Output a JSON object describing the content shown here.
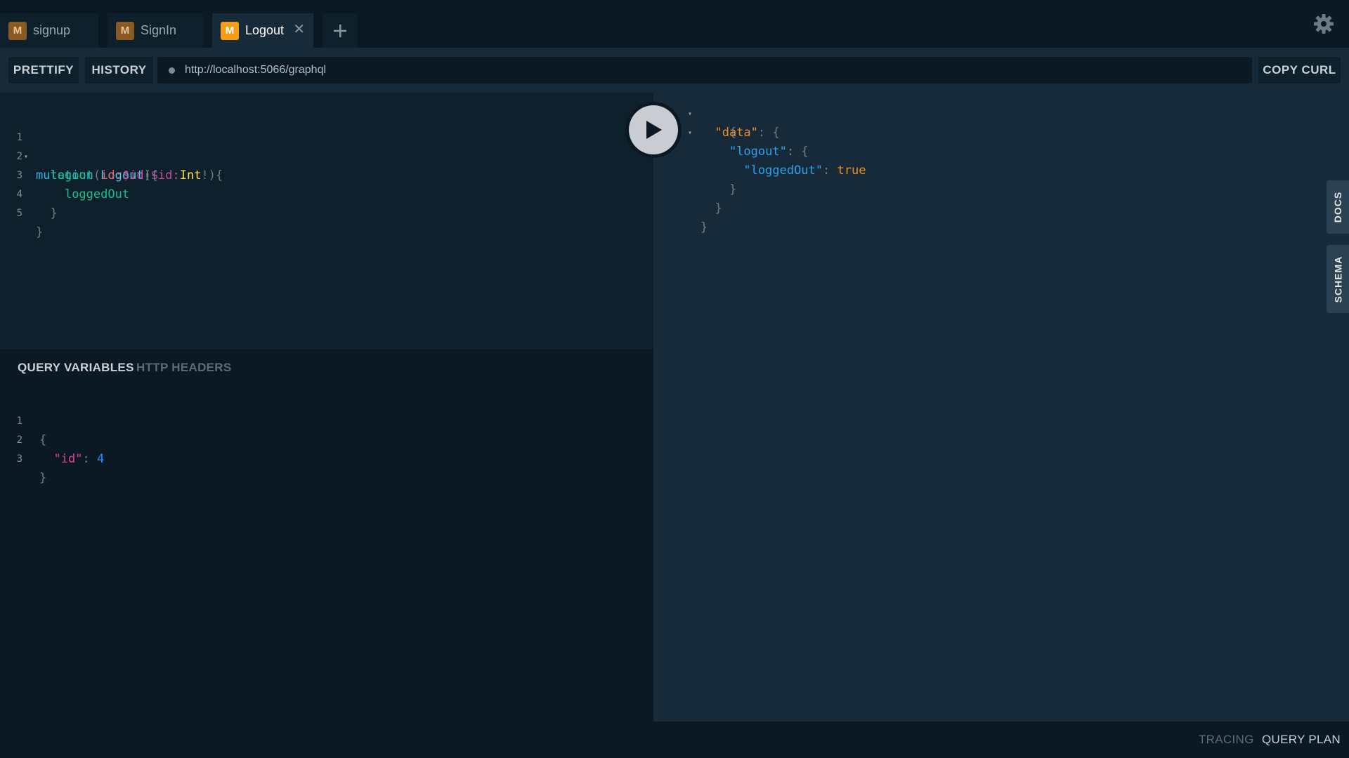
{
  "tabs": [
    {
      "badge": "M",
      "label": "signup"
    },
    {
      "badge": "M",
      "label": "SignIn"
    },
    {
      "badge": "M",
      "label": "Logout",
      "close": "✕"
    }
  ],
  "toolbar": {
    "prettify": "PRETTIFY",
    "history": "HISTORY",
    "url": "http://localhost:5066/graphql",
    "copy_curl": "COPY CURL"
  },
  "editor": {
    "line_numbers": [
      "1",
      "2",
      "3",
      "4",
      "5"
    ],
    "l1": {
      "kw": "mutation",
      "name": "Logout",
      "open": "(",
      "var": "$id",
      "colon": ":",
      "type": "Int",
      "bang": "!",
      "close": "){"
    },
    "l2": {
      "field": "logout",
      "open": "(",
      "arg": "id",
      "colon": ":",
      "var": "$id",
      "close": "){"
    },
    "l3": {
      "field": "loggedOut"
    },
    "l4": "}",
    "l5": "}"
  },
  "variables": {
    "tab_active": "QUERY VARIABLES",
    "tab_inactive": "HTTP HEADERS",
    "line_numbers": [
      "1",
      "2",
      "3"
    ],
    "l1": "{",
    "key": "\"id\"",
    "colon": ":",
    "value": "4",
    "l3": "}"
  },
  "result": {
    "open": "{",
    "data_key": "\"data\"",
    "logout_key": "\"logout\"",
    "loggedout_key": "\"loggedOut\"",
    "colon": ":",
    "brace_open": "{",
    "loggedout_value": "true",
    "brace_close": "}"
  },
  "side": {
    "docs": "DOCS",
    "schema": "SCHEMA"
  },
  "bottom": {
    "tracing": "TRACING",
    "query_plan": "QUERY PLAN"
  },
  "colors": {
    "accent": "#f59d15",
    "background": "#0b1924",
    "panel": "#172a3a"
  }
}
